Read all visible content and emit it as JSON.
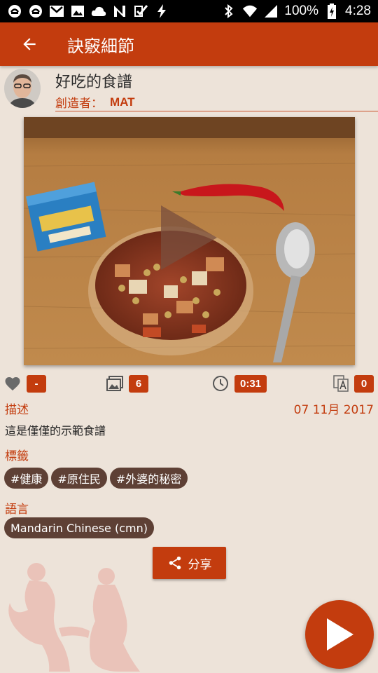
{
  "status_bar": {
    "battery": "100%",
    "time": "4:28",
    "left_icons": [
      "notification-icon-1",
      "notification-icon-2",
      "gmail-icon",
      "image-icon",
      "cloud-icon",
      "n-icon",
      "checkbox-icon",
      "flash-icon"
    ],
    "right_icons": [
      "bluetooth-icon",
      "wifi-icon",
      "signal-icon",
      "battery-icon"
    ]
  },
  "app_bar": {
    "title": "訣竅細節",
    "back_icon": "arrow-back-icon"
  },
  "recipe": {
    "title": "好吃的食譜",
    "creator_label": "創造者：",
    "creator_name": "MAT"
  },
  "stats": {
    "likes": "-",
    "images": "6",
    "duration": "0:31",
    "translations": "0"
  },
  "description": {
    "label": "描述",
    "date": "07 11月 2017",
    "text": "這是僅僅的示範食譜"
  },
  "tags": {
    "label": "標籤",
    "items": [
      "#健康",
      "#原住民",
      "#外婆的秘密"
    ]
  },
  "language": {
    "label": "語言",
    "items": [
      "Mandarin Chinese (cmn)"
    ]
  },
  "share": {
    "label": "分享"
  },
  "colors": {
    "accent": "#c33c0e",
    "background": "#ede3d9",
    "chip": "#5e4035"
  }
}
